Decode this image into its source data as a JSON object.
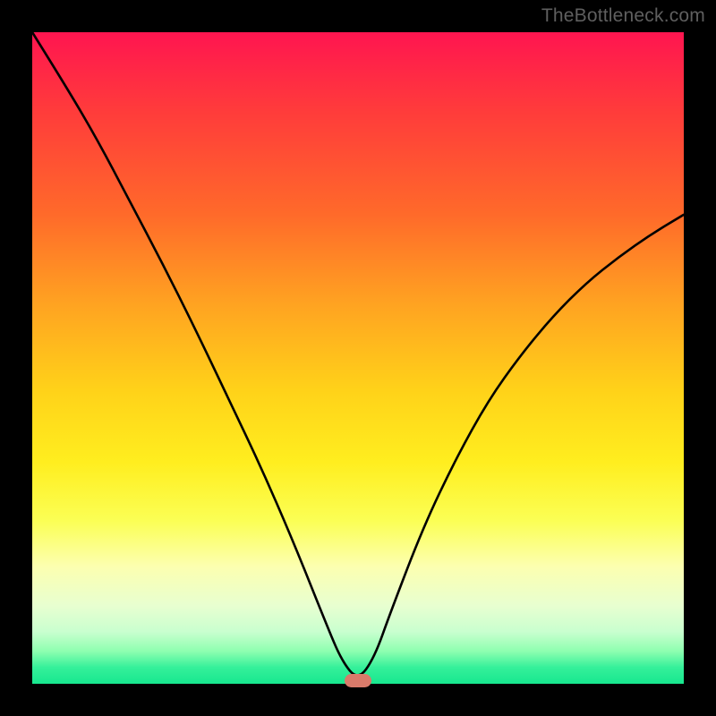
{
  "watermark": "TheBottleneck.com",
  "chart_data": {
    "type": "line",
    "title": "",
    "xlabel": "",
    "ylabel": "",
    "xlim": [
      0,
      1
    ],
    "ylim": [
      0,
      1
    ],
    "series": [
      {
        "name": "curve",
        "x": [
          0.0,
          0.05,
          0.1,
          0.15,
          0.2,
          0.25,
          0.3,
          0.35,
          0.4,
          0.45,
          0.475,
          0.5,
          0.525,
          0.55,
          0.6,
          0.65,
          0.7,
          0.75,
          0.8,
          0.85,
          0.9,
          0.95,
          1.0
        ],
        "y": [
          1.0,
          0.92,
          0.835,
          0.74,
          0.645,
          0.545,
          0.44,
          0.335,
          0.22,
          0.095,
          0.035,
          0.005,
          0.04,
          0.11,
          0.24,
          0.345,
          0.435,
          0.505,
          0.565,
          0.615,
          0.655,
          0.69,
          0.72
        ]
      }
    ],
    "marker": {
      "x": 0.5,
      "y": 0.005
    },
    "background_gradient": {
      "top": "#ff1550",
      "mid": "#ffee1f",
      "bottom": "#17e78f"
    }
  }
}
